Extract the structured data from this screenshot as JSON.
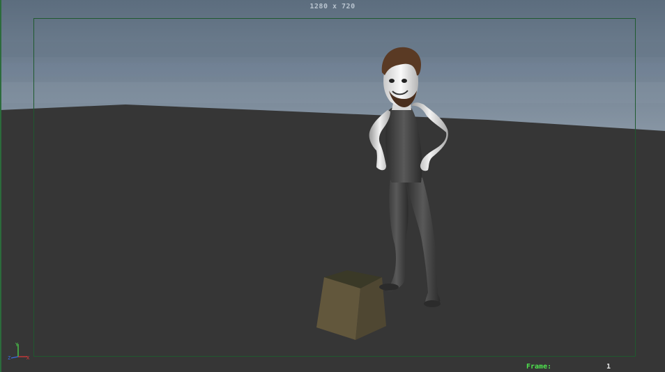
{
  "viewport": {
    "resolution_label": "1280 x 720",
    "frame_label": "Frame:",
    "frame_value": "1"
  },
  "axis": {
    "y_label": "Y",
    "z_label": "Z",
    "x_label": "X"
  },
  "colors": {
    "ground": "#363636",
    "sky_top": "#5f6f80",
    "sky_bottom": "#8594a3",
    "gate": "#1f5a2f",
    "hud_green": "#4ee34e",
    "box_top": "#3b3a28",
    "box_side": "#5a5038"
  },
  "scene_objects": [
    "character",
    "box",
    "ground-plane"
  ]
}
